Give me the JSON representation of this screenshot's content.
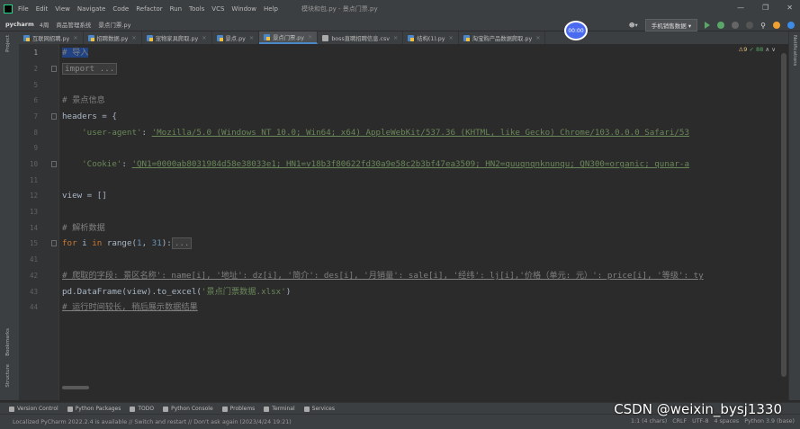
{
  "menubar": {
    "items": [
      "File",
      "Edit",
      "View",
      "Navigate",
      "Code",
      "Refactor",
      "Run",
      "Tools",
      "VCS",
      "Window",
      "Help"
    ],
    "window_title": "模块和包.py - 景点门票.py",
    "controls": [
      "—",
      "❐",
      "✕"
    ]
  },
  "navbar": {
    "project": "pycharm",
    "crumbs": [
      "4周",
      "商品管理系统",
      "景点门票.py"
    ],
    "run_config": "手机销售数据 ▾",
    "timer": "00:00"
  },
  "tabs": [
    {
      "label": "互联网招聘.py",
      "active": false
    },
    {
      "label": "招聘数据.py",
      "active": false
    },
    {
      "label": "宠物家具爬取.py",
      "active": false
    },
    {
      "label": "景点.py",
      "active": false
    },
    {
      "label": "景点门票.py",
      "active": true
    },
    {
      "label": "boss直聘招聘信息.csv",
      "active": false
    },
    {
      "label": "结构(1).py",
      "active": false
    },
    {
      "label": "淘宝购产品数据爬取.py",
      "active": false
    }
  ],
  "inspection": {
    "warnings": "⚠9",
    "ok": "✓ 88",
    "nav": "∧ ∨"
  },
  "side_labels": {
    "project": "Project",
    "structure": "Structure",
    "bookmarks": "Bookmarks",
    "notifications": "Notifications"
  },
  "line_numbers": [
    "1",
    "2",
    "5",
    "6",
    "7",
    "8",
    "9",
    "10",
    "11",
    "12",
    "13",
    "14",
    "15",
    "41",
    "42",
    "43",
    "44"
  ],
  "code": {
    "l1": "# 导入",
    "l2": "import ...",
    "l6": "# 景点信息",
    "l7": "headers = {",
    "l8_key": "'user-agent'",
    "l8_val": "'Mozilla/5.0 (Windows NT 10.0; Win64; x64) AppleWebKit/537.36 (KHTML, like Gecko) Chrome/103.0.0.0 Safari/53",
    "l10_key": "'Cookie'",
    "l10_val": "'QN1=0000ab8031984d58e38033e1; HN1=v18b3f80622fd30a9e58c2b3bf47ea3509; HN2=quuqnqnknunqu; QN300=organic; qunar-a",
    "l12": "view = []",
    "l14": "# 解析数据",
    "l15_kw": "for",
    "l15_a": " i ",
    "l15_kw2": "in",
    "l15_b": " range(",
    "l15_n1": "1",
    "l15_c": ", ",
    "l15_n2": "31",
    "l15_d": "):",
    "l15_fold": "...",
    "l42": "# 爬取的字段: 景区名称': name[i], '地址': dz[i], '简介': des[i], '月销量': sale[i], '经纬': lj[i],'价格（单元: 元）': price[i], '等级': ty",
    "l43_a": "pd.DataFrame(view).to_excel(",
    "l43_s": "'景点门票数据.xlsx'",
    "l43_b": ")",
    "l44": "# 运行时间较长, 稍后展示数据结果"
  },
  "tool_windows": [
    "Version Control",
    "Python Packages",
    "TODO",
    "Python Console",
    "Problems",
    "Terminal",
    "Services"
  ],
  "status": {
    "message": "Localized PyCharm 2022.2.4 is available // Switch and restart // Don't ask again (2023/4/24 19:21)",
    "position": "1:1 (4 chars)",
    "line_sep": "CRLF",
    "encoding": "UTF-8",
    "indent": "4 spaces",
    "interpreter": "Python 3.9 (base)"
  },
  "watermark": "CSDN @weixin_bysj1330"
}
